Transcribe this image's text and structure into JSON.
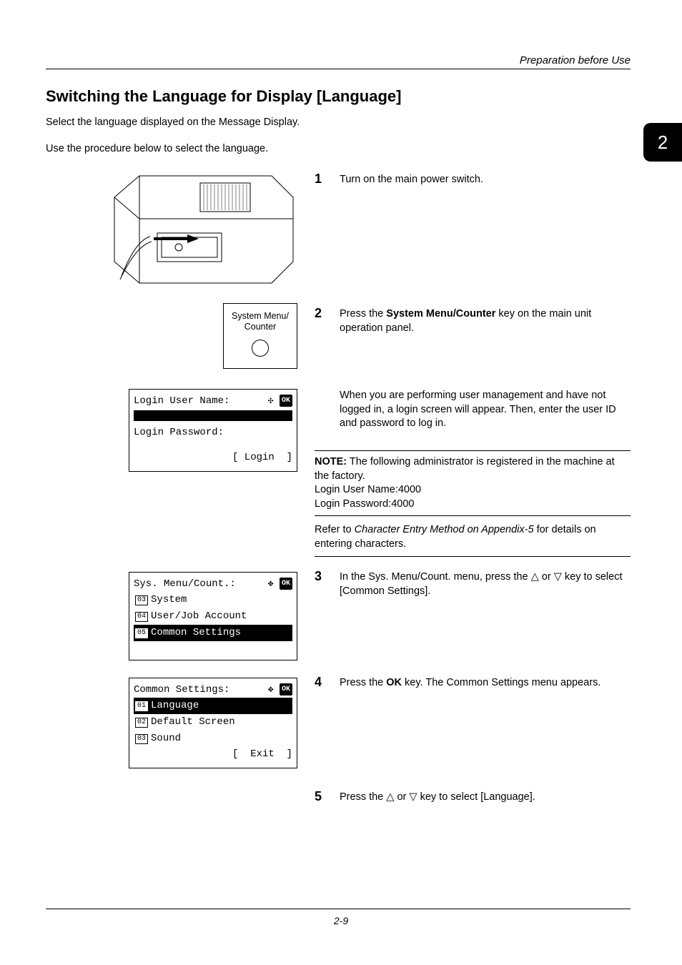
{
  "header": {
    "running": "Preparation before Use",
    "tab": "2"
  },
  "title": "Switching the Language for Display [Language]",
  "intro": {
    "p1": "Select the language displayed on the Message Display.",
    "p2": "Use the procedure below to select the language."
  },
  "steps": {
    "s1": {
      "num": "1",
      "text": "Turn on the main power switch."
    },
    "s2": {
      "num": "2",
      "text_pre": "Press the ",
      "bold": "System Menu/Counter",
      "text_post": " key on the main unit operation panel."
    },
    "s2b": "When you are performing user management and have not logged in, a login screen will appear. Then, enter the user ID and password to log in.",
    "s3": {
      "num": "3",
      "text_pre": "In the Sys. Menu/Count. menu, press the ",
      "tri1": "△",
      "text_mid": " or ",
      "tri2": "▽",
      "text_post": " key to select [Common Settings]."
    },
    "s4": {
      "num": "4",
      "text_pre": "Press the ",
      "bold": "OK",
      "text_post": " key. The Common Settings menu appears."
    },
    "s5": {
      "num": "5",
      "text_pre": "Press the ",
      "tri1": "△",
      "text_mid": " or ",
      "tri2": "▽",
      "text_post": " key to select [Language]."
    }
  },
  "note": {
    "label": "NOTE:",
    "l1": " The following administrator is registered in the machine at the factory.",
    "l2": "Login User Name:4000",
    "l3": "Login Password:4000"
  },
  "refer": {
    "pre": "Refer to ",
    "link": "Character Entry Method on Appendix-5",
    "post": " for details on entering characters."
  },
  "button_fig": {
    "l1": "System Menu/",
    "l2": "Counter"
  },
  "lcd_login": {
    "title": "Login User Name:",
    "pw": "Login Password:",
    "soft": "[ Login  ]"
  },
  "lcd_sys": {
    "title": "Sys. Menu/Count.:",
    "r1": {
      "n": "03",
      "t": " System"
    },
    "r2": {
      "n": "04",
      "t": " User/Job Account"
    },
    "r3": {
      "n": "05",
      "t": " Common Settings"
    }
  },
  "lcd_common": {
    "title": "Common Settings:",
    "r1": {
      "n": "01",
      "t": " Language"
    },
    "r2": {
      "n": "02",
      "t": " Default Screen"
    },
    "r3": {
      "n": "03",
      "t": " Sound"
    },
    "soft": "[  Exit  ]"
  },
  "ok": "OK",
  "nav": "✥",
  "nav2": "✣",
  "footer": "2-9"
}
